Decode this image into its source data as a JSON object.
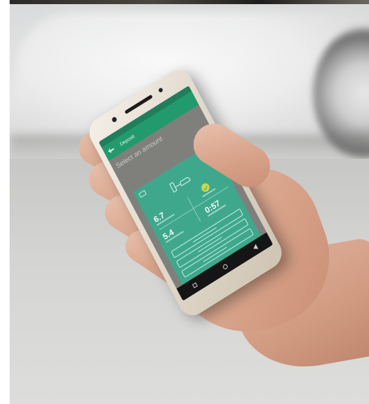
{
  "app": {
    "screen_title": "Deposit",
    "heading": "Select an amount"
  },
  "stats": {
    "value_a": "6.7",
    "value_b": "5.4",
    "value_c": "0:57"
  },
  "icons": {
    "back": "arrow-left-icon",
    "card": "card-icon",
    "charger": "ev-charger-icon",
    "check": "check-circle-icon",
    "close": "close-icon",
    "nav": [
      "square-icon",
      "circle-icon",
      "triangle-back-icon"
    ]
  },
  "colors": {
    "status_bar": "#1e7f5c",
    "app_bar": "#239a6e",
    "modal": "#3fa88c",
    "check_badge": "#c9d94a",
    "stop_bar": "#1d2a27"
  }
}
